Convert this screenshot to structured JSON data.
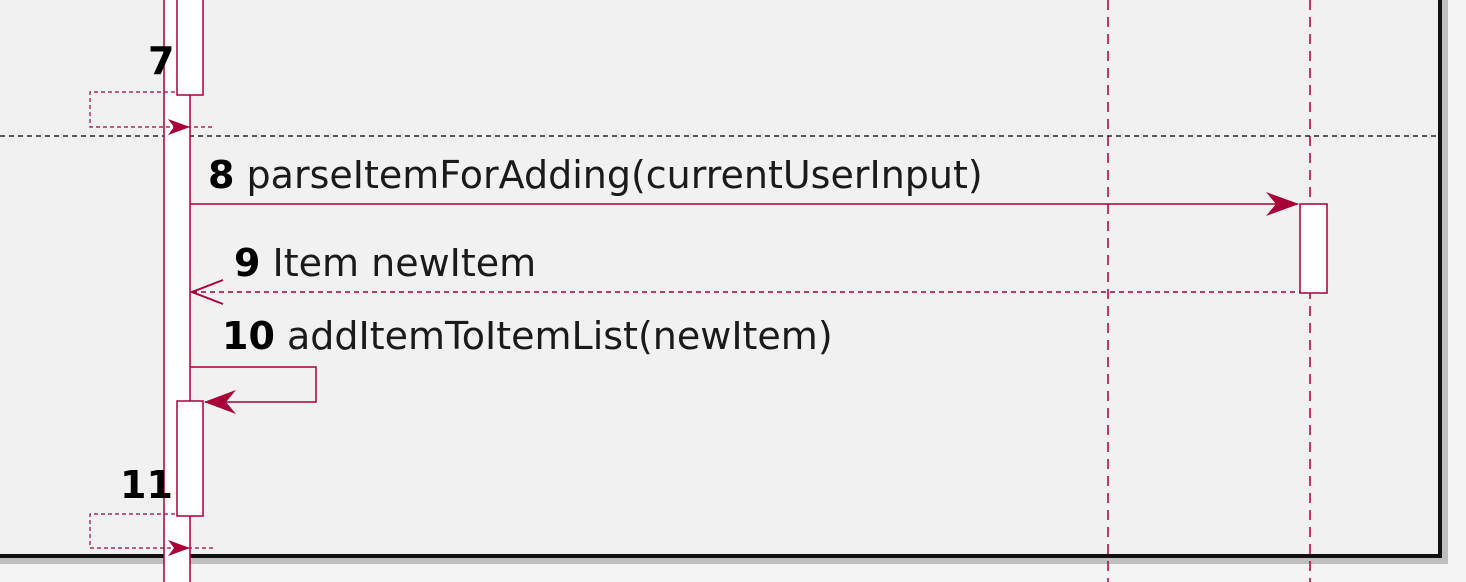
{
  "diagram": {
    "type": "sequence",
    "colors": {
      "line": "#a80036",
      "frame": "#111111",
      "background": "#f1f1f1",
      "activation": "#fefefe"
    },
    "messages": [
      {
        "number": "7",
        "text": ""
      },
      {
        "number": "8",
        "text": "parseItemForAdding(currentUserInput)"
      },
      {
        "number": "9",
        "text": "Item newItem"
      },
      {
        "number": "10",
        "text": "addItemToItemList(newItem)"
      },
      {
        "number": "11",
        "text": ""
      }
    ]
  }
}
